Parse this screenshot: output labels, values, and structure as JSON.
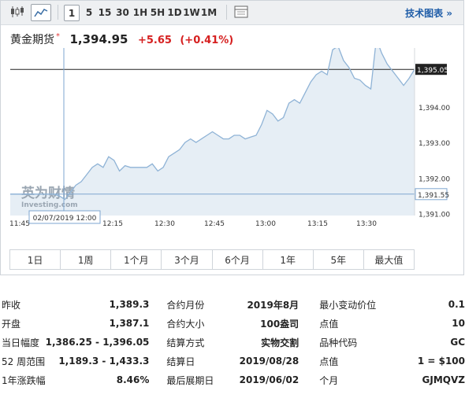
{
  "toolbar": {
    "intervals": [
      "1",
      "5",
      "15",
      "30",
      "1H",
      "5H",
      "1D",
      "1W",
      "1M"
    ],
    "selected": "1",
    "tech_link": "技术图表 »"
  },
  "quote": {
    "name": "黄金期货",
    "price": "1,394.95",
    "change": "+5.65",
    "change_pct": "(+0.41%)",
    "change_color": "#d62020"
  },
  "chart_data": {
    "type": "area",
    "x_ticks": [
      "11:45",
      "12:15",
      "12:30",
      "12:45",
      "13:00",
      "13:15",
      "13:30"
    ],
    "y_ticks": [
      "1,394.00",
      "1,393.00",
      "1,392.00",
      "1,391.00"
    ],
    "ylim": [
      1391.0,
      1395.65
    ],
    "current_price_label": "1,395.05",
    "current_price": 1395.05,
    "open_line_label": "1,391.55",
    "open_line_price": 1391.55,
    "crosshair_time_label": "02/07/2019 12:00",
    "watermark": "英为财情 Investing.com",
    "line_color": "#8fb3d6",
    "fill_color": "#e6eef5",
    "series": [
      {
        "values": [
          1391.55,
          1391.55,
          1391.55,
          1391.55,
          1391.55,
          1391.55,
          1391.55,
          1391.55,
          1391.55,
          1391.5,
          1391.4,
          1391.6,
          1391.8,
          1391.9,
          1392.1,
          1392.3,
          1392.4,
          1392.3,
          1392.6,
          1392.5,
          1392.2,
          1392.35,
          1392.3,
          1392.3,
          1392.3,
          1392.3,
          1392.4,
          1392.2,
          1392.3,
          1392.6,
          1392.7,
          1392.8,
          1393.0,
          1393.1,
          1393.0,
          1393.1,
          1393.2,
          1393.3,
          1393.2,
          1393.1,
          1393.1,
          1393.2,
          1393.2,
          1393.1,
          1393.15,
          1393.2,
          1393.5,
          1393.9,
          1393.8,
          1393.6,
          1393.7,
          1394.1,
          1394.2,
          1394.1,
          1394.4,
          1394.7,
          1394.9,
          1395.0,
          1394.9,
          1395.6,
          1395.7,
          1395.3,
          1395.1,
          1394.8,
          1394.75,
          1394.6,
          1394.5,
          1395.9,
          1395.5,
          1395.2,
          1395.0,
          1394.8,
          1394.6,
          1394.8,
          1395.05
        ]
      }
    ]
  },
  "ranges": [
    "1日",
    "1周",
    "1个月",
    "3个月",
    "6个月",
    "1年",
    "5年",
    "最大值"
  ],
  "stats": [
    [
      {
        "label": "昨收",
        "value": "1,389.3"
      },
      {
        "label": "合约月份",
        "value": "2019年8月"
      },
      {
        "label": "最小变动价位",
        "value": "0.1"
      }
    ],
    [
      {
        "label": "开盘",
        "value": "1,387.1"
      },
      {
        "label": "合约大小",
        "value": "100盎司"
      },
      {
        "label": "点值",
        "value": "10"
      }
    ],
    [
      {
        "label": "当日幅度",
        "value": "1,386.25 - 1,396.05"
      },
      {
        "label": "结算方式",
        "value": "实物交割"
      },
      {
        "label": "品种代码",
        "value": "GC"
      }
    ],
    [
      {
        "label": "52 周范围",
        "value": "1,189.3 - 1,433.3"
      },
      {
        "label": "结算日",
        "value": "2019/08/28"
      },
      {
        "label": "点值",
        "value": "1 = $100"
      }
    ],
    [
      {
        "label": "1年涨跌幅",
        "value": "8.46%"
      },
      {
        "label": "最后展期日",
        "value": "2019/06/02"
      },
      {
        "label": "个月",
        "value": "GJMQVZ"
      }
    ]
  ]
}
